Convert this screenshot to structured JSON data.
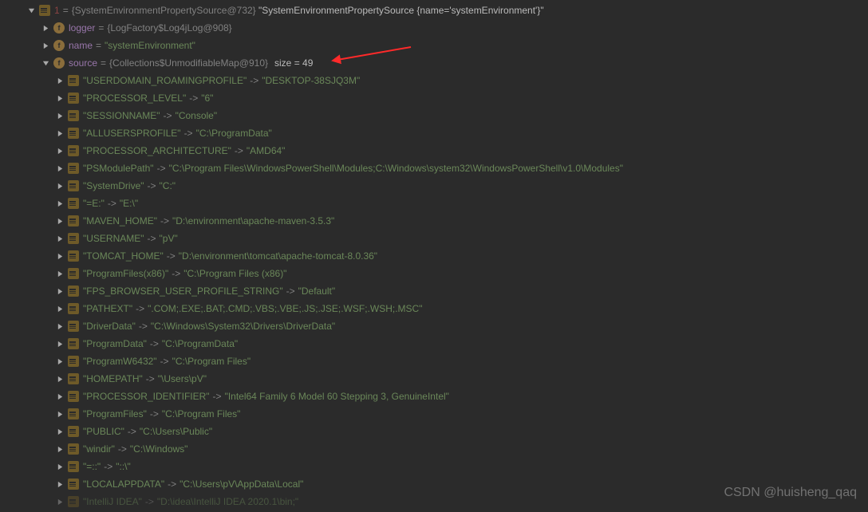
{
  "root": {
    "idx_label": "1",
    "eq": "=",
    "obj": "{SystemEnvironmentPropertySource@732}",
    "val": "\"SystemEnvironmentPropertySource {name='systemEnvironment'}\""
  },
  "logger": {
    "name": "logger",
    "eq": "=",
    "obj": "{LogFactory$Log4jLog@908}"
  },
  "name_f": {
    "name": "name",
    "eq": "=",
    "val": "\"systemEnvironment\""
  },
  "source": {
    "name": "source",
    "eq": "=",
    "obj": "{Collections$UnmodifiableMap@910}",
    "size": "size = 49"
  },
  "entries": [
    {
      "k": "\"USERDOMAIN_ROAMINGPROFILE\"",
      "arrow": "->",
      "v": "\"DESKTOP-38SJQ3M\""
    },
    {
      "k": "\"PROCESSOR_LEVEL\"",
      "arrow": "->",
      "v": "\"6\""
    },
    {
      "k": "\"SESSIONNAME\"",
      "arrow": "->",
      "v": "\"Console\""
    },
    {
      "k": "\"ALLUSERSPROFILE\"",
      "arrow": "->",
      "v": "\"C:\\ProgramData\""
    },
    {
      "k": "\"PROCESSOR_ARCHITECTURE\"",
      "arrow": "->",
      "v": "\"AMD64\""
    },
    {
      "k": "\"PSModulePath\"",
      "arrow": "->",
      "v": "\"C:\\Program Files\\WindowsPowerShell\\Modules;C:\\Windows\\system32\\WindowsPowerShell\\v1.0\\Modules\""
    },
    {
      "k": "\"SystemDrive\"",
      "arrow": "->",
      "v": "\"C:\""
    },
    {
      "k": "\"=E:\"",
      "arrow": "->",
      "v": "\"E:\\\""
    },
    {
      "k": "\"MAVEN_HOME\"",
      "arrow": "->",
      "v": "\"D:\\environment\\apache-maven-3.5.3\""
    },
    {
      "k": "\"USERNAME\"",
      "arrow": "->",
      "v": "\"pV\""
    },
    {
      "k": "\"TOMCAT_HOME\"",
      "arrow": "->",
      "v": "\"D:\\environment\\tomcat\\apache-tomcat-8.0.36\""
    },
    {
      "k": "\"ProgramFiles(x86)\"",
      "arrow": "->",
      "v": "\"C:\\Program Files (x86)\""
    },
    {
      "k": "\"FPS_BROWSER_USER_PROFILE_STRING\"",
      "arrow": "->",
      "v": "\"Default\""
    },
    {
      "k": "\"PATHEXT\"",
      "arrow": "->",
      "v": "\".COM;.EXE;.BAT;.CMD;.VBS;.VBE;.JS;.JSE;.WSF;.WSH;.MSC\""
    },
    {
      "k": "\"DriverData\"",
      "arrow": "->",
      "v": "\"C:\\Windows\\System32\\Drivers\\DriverData\""
    },
    {
      "k": "\"ProgramData\"",
      "arrow": "->",
      "v": "\"C:\\ProgramData\""
    },
    {
      "k": "\"ProgramW6432\"",
      "arrow": "->",
      "v": "\"C:\\Program Files\""
    },
    {
      "k": "\"HOMEPATH\"",
      "arrow": "->",
      "v": "\"\\Users\\pV\""
    },
    {
      "k": "\"PROCESSOR_IDENTIFIER\"",
      "arrow": "->",
      "v": "\"Intel64 Family 6 Model 60 Stepping 3, GenuineIntel\""
    },
    {
      "k": "\"ProgramFiles\"",
      "arrow": "->",
      "v": "\"C:\\Program Files\""
    },
    {
      "k": "\"PUBLIC\"",
      "arrow": "->",
      "v": "\"C:\\Users\\Public\""
    },
    {
      "k": "\"windir\"",
      "arrow": "->",
      "v": "\"C:\\Windows\""
    },
    {
      "k": "\"=::\"",
      "arrow": "->",
      "v": "\"::\\\""
    },
    {
      "k": "\"LOCALAPPDATA\"",
      "arrow": "->",
      "v": "\"C:\\Users\\pV\\AppData\\Local\""
    },
    {
      "k": "\"IntelliJ IDEA\"",
      "arrow": "->",
      "v": "\"D:\\idea\\IntelliJ IDEA 2020.1\\bin;\""
    }
  ],
  "watermark": "CSDN @huisheng_qaq"
}
